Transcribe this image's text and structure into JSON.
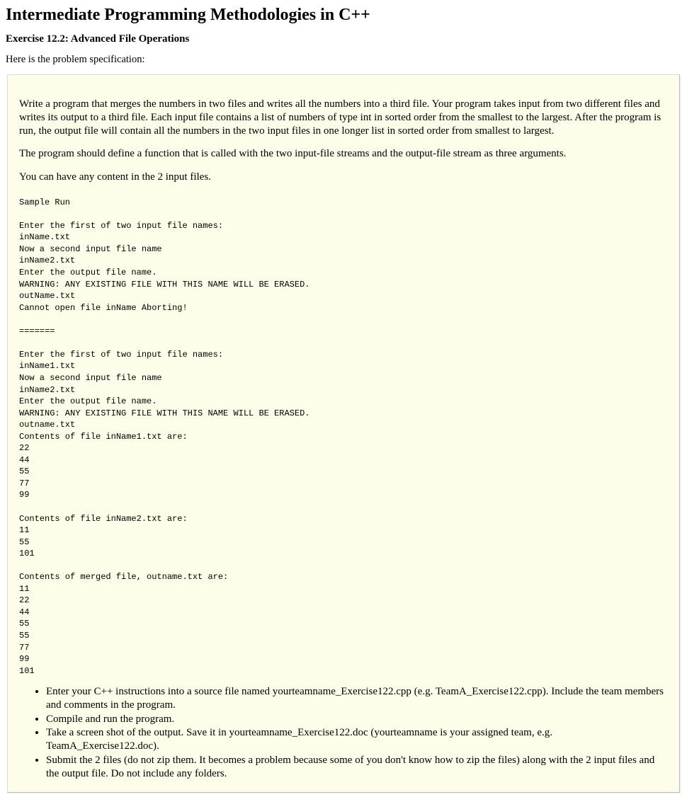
{
  "title": "Intermediate Programming Methodologies in C++",
  "subtitle": "Exercise 12.2: Advanced File Operations",
  "intro": "Here is the problem specification:",
  "spec": {
    "p1": "Write a program that merges the numbers in two files and writes all the numbers into a third file. Your program takes input from two different files and writes its output to a third file. Each input file contains a list of numbers of type int in sorted order from the smallest to the largest. After the program is run, the output file will contain all the numbers in the two input files in one longer list in sorted order from smallest to largest.",
    "p2": "The program should define a function that is called with the two input-file streams and the output-file stream as three arguments.",
    "p3": "You can have any content in the 2 input files.",
    "sample": "Sample Run\n\nEnter the first of two input file names:\ninName.txt\nNow a second input file name\ninName2.txt\nEnter the output file name.\nWARNING: ANY EXISTING FILE WITH THIS NAME WILL BE ERASED.\noutName.txt\nCannot open file inName Aborting!\n\n=======\n\nEnter the first of two input file names:\ninName1.txt\nNow a second input file name\ninName2.txt\nEnter the output file name.\nWARNING: ANY EXISTING FILE WITH THIS NAME WILL BE ERASED.\noutname.txt\nContents of file inName1.txt are:\n22\n44\n55\n77\n99\n\nContents of file inName2.txt are:\n11\n55\n101\n\nContents of merged file, outname.txt are:\n11\n22\n44\n55\n55\n77\n99\n101",
    "steps": {
      "s1": "Enter your C++ instructions into a source file named yourteamname_Exercise122.cpp (e.g. TeamA_Exercise122.cpp). Include the team members and comments in the program.",
      "s2": "Compile and run the program.",
      "s3": "Take a screen shot of the output. Save it in yourteamname_Exercise122.doc (yourteamname is your assigned team, e.g. TeamA_Exercise122.doc).",
      "s4": "Submit the 2 files (do not zip them. It becomes a problem because some of you don't know how to zip the files) along with the 2 input files and the output file. Do not include any folders."
    }
  }
}
